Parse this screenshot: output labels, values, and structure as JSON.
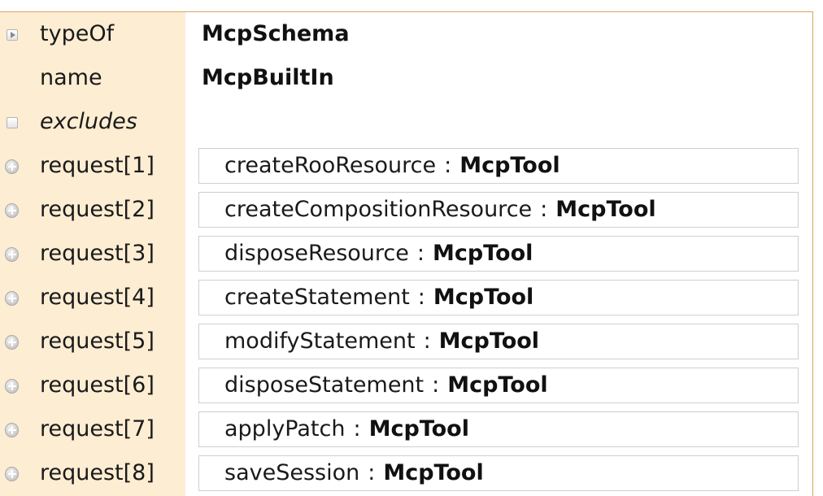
{
  "fields": {
    "typeOf": {
      "label": "typeOf",
      "value": "McpSchema"
    },
    "name": {
      "label": "name",
      "value": "McpBuiltIn"
    },
    "excludes": {
      "label": "excludes"
    }
  },
  "separator": ":",
  "requests": [
    {
      "label": "request[1]",
      "name": "createRooResource",
      "type": "McpTool"
    },
    {
      "label": "request[2]",
      "name": "createCompositionResource",
      "type": "McpTool"
    },
    {
      "label": "request[3]",
      "name": "disposeResource",
      "type": "McpTool"
    },
    {
      "label": "request[4]",
      "name": "createStatement",
      "type": "McpTool"
    },
    {
      "label": "request[5]",
      "name": "modifyStatement",
      "type": "McpTool"
    },
    {
      "label": "request[6]",
      "name": "disposeStatement",
      "type": "McpTool"
    },
    {
      "label": "request[7]",
      "name": "applyPatch",
      "type": "McpTool"
    },
    {
      "label": "request[8]",
      "name": "saveSession",
      "type": "McpTool"
    }
  ],
  "icons": {
    "typeOf": "expand-triangle-icon",
    "excludes": "empty-checkbox-icon",
    "request": "add-circle-icon"
  },
  "colors": {
    "label_column": "#fdedd3",
    "panel_border": "#d6a65c"
  }
}
